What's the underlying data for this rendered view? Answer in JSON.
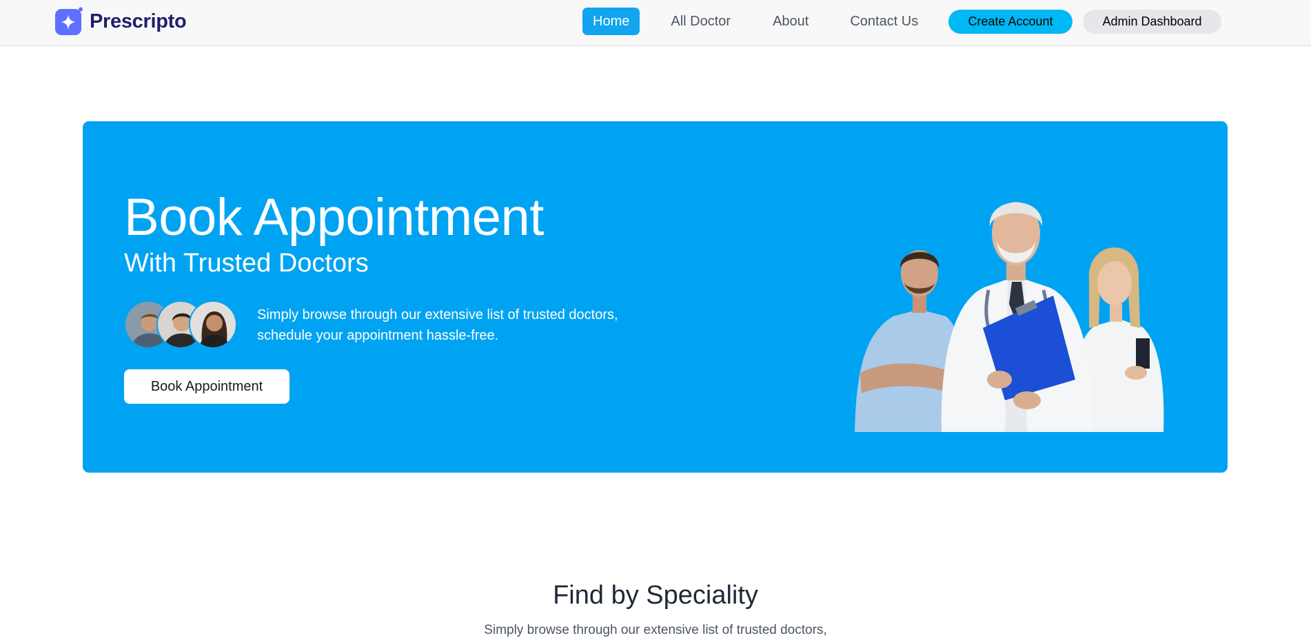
{
  "brand": {
    "name": "Prescripto",
    "logo_icon": "sparkle-logo-icon",
    "logo_color": "#5f6fff"
  },
  "nav": {
    "links": [
      {
        "label": "Home",
        "active": true
      },
      {
        "label": "All Doctor",
        "active": false
      },
      {
        "label": "About",
        "active": false
      },
      {
        "label": "Contact Us",
        "active": false
      }
    ],
    "create_account_label": "Create Account",
    "admin_dashboard_label": "Admin Dashboard"
  },
  "hero": {
    "title": "Book Appointment",
    "subtitle": "With Trusted Doctors",
    "description_line1": "Simply browse through our extensive list of trusted doctors,",
    "description_line2": "schedule your appointment hassle-free.",
    "button_label": "Book Appointment",
    "background_color": "#00a3f2"
  },
  "speciality": {
    "title": "Find by Speciality",
    "description": "Simply browse through our extensive list of trusted doctors,"
  },
  "colors": {
    "accent": "#12a4ee",
    "create_button": "#00b8f4",
    "admin_button": "#e5e7eb"
  }
}
